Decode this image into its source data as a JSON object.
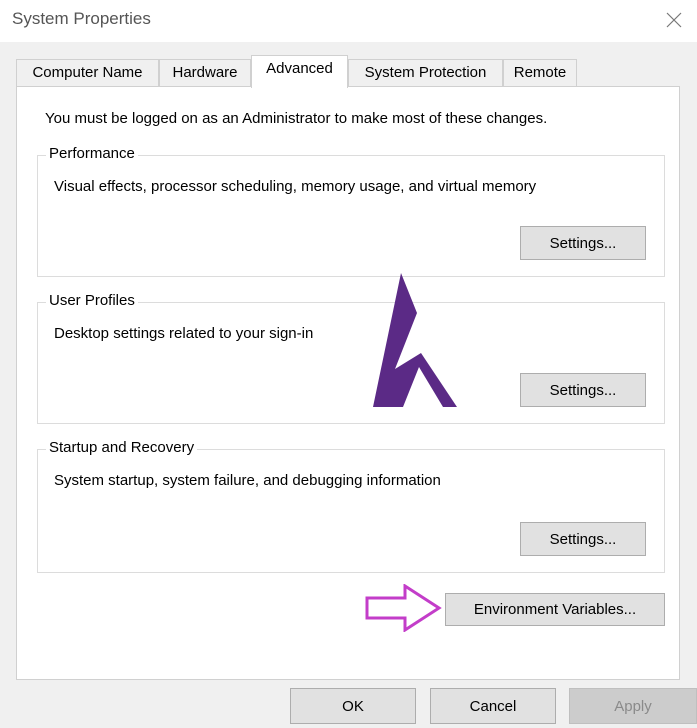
{
  "window": {
    "title": "System Properties",
    "close_icon": "close-icon"
  },
  "tabs": [
    {
      "label": "Computer Name"
    },
    {
      "label": "Hardware"
    },
    {
      "label": "Advanced",
      "active": true
    },
    {
      "label": "System Protection"
    },
    {
      "label": "Remote"
    }
  ],
  "advanced": {
    "notice": "You must be logged on as an Administrator to make most of these changes.",
    "performance": {
      "legend": "Performance",
      "description": "Visual effects, processor scheduling, memory usage, and virtual memory",
      "button": "Settings..."
    },
    "user_profiles": {
      "legend": "User Profiles",
      "description": "Desktop settings related to your sign-in",
      "button": "Settings..."
    },
    "startup": {
      "legend": "Startup and Recovery",
      "description": "System startup, system failure, and debugging information",
      "button": "Settings..."
    },
    "env_button": "Environment Variables...",
    "arrow_icon": "arrow-right-outline-icon",
    "watermark_icon": "h-logo-icon"
  },
  "footer": {
    "ok": "OK",
    "cancel": "Cancel",
    "apply": "Apply"
  },
  "colors": {
    "watermark": "#5b2a86",
    "arrow": "#c33dc9"
  }
}
